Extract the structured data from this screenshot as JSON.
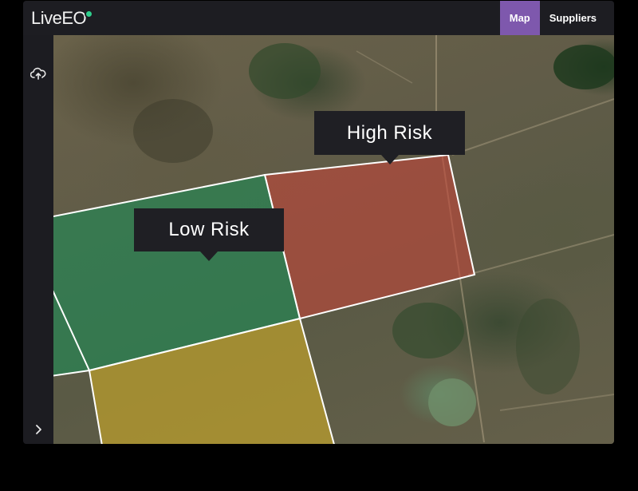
{
  "brand": {
    "name": "LiveEO"
  },
  "nav": {
    "tabs": [
      {
        "label": "Map",
        "active": true
      },
      {
        "label": "Suppliers",
        "active": false
      }
    ]
  },
  "sidebar": {
    "upload_icon": "cloud-upload-icon",
    "expand_icon": "chevron-right-icon"
  },
  "map": {
    "parcels": [
      {
        "risk": "high",
        "color": "#c0473a"
      },
      {
        "risk": "low",
        "color": "#1f8a55"
      },
      {
        "risk": "medium",
        "color": "#c7a72a"
      }
    ],
    "labels": {
      "high_risk": "High Risk",
      "low_risk": "Low Risk"
    }
  },
  "colors": {
    "accent": "#7e58ad",
    "boundary": "#ffffff"
  }
}
